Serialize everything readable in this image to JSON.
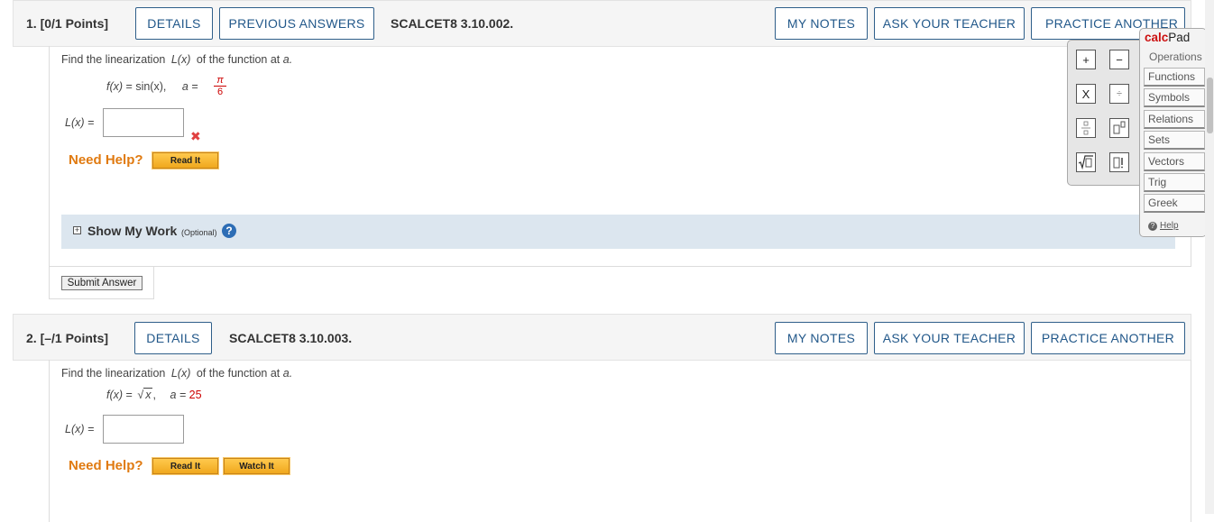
{
  "q1": {
    "points": "1. [0/1 Points]",
    "details": "DETAILS",
    "previous_answers": "PREVIOUS ANSWERS",
    "code": "SCALCET8 3.10.002.",
    "my_notes": "MY NOTES",
    "ask_teacher": "ASK YOUR TEACHER",
    "practice": "PRACTICE ANOTHER",
    "prompt_a": "Find the linearization",
    "prompt_fn": "L(x)",
    "prompt_b": "of the function at",
    "prompt_var": "a.",
    "func_f": "f(x)",
    "func_eq": "= sin(x),",
    "a_label": "a =",
    "a_num": "π",
    "a_den": "6",
    "answer_label": "L(x) =",
    "answer_value": "",
    "wrong_mark": "✖",
    "need_help": "Need Help?",
    "read_it": "Read It",
    "show_work": "Show My Work",
    "optional": "(Optional)",
    "submit": "Submit Answer"
  },
  "q2": {
    "points": "2. [–/1 Points]",
    "details": "DETAILS",
    "code": "SCALCET8 3.10.003.",
    "my_notes": "MY NOTES",
    "ask_teacher": "ASK YOUR TEACHER",
    "practice": "PRACTICE ANOTHER",
    "prompt_a": "Find the linearization",
    "prompt_fn": "L(x)",
    "prompt_b": "of the function at",
    "prompt_var": "a.",
    "func_f": "f(x)",
    "func_eq": "=",
    "func_sqrt_arg": "x",
    "func_comma": ",",
    "a_label": "a =",
    "a_value": "25",
    "answer_label": "L(x) =",
    "answer_value": "",
    "need_help": "Need Help?",
    "read_it": "Read It",
    "watch_it": "Watch It"
  },
  "calcpad": {
    "title_calc": "calc",
    "title_pad": "Pad",
    "keys": [
      "+",
      "−",
      "X",
      "÷"
    ],
    "menu": [
      "Operations",
      "Functions",
      "Symbols",
      "Relations",
      "Sets",
      "Vectors",
      "Trig",
      "Greek"
    ],
    "help": "Help"
  },
  "colors": {
    "accent": "#22588a",
    "need_help": "#e07a10",
    "value_red": "#cc0000",
    "showwork_bg": "#dce6ef"
  }
}
